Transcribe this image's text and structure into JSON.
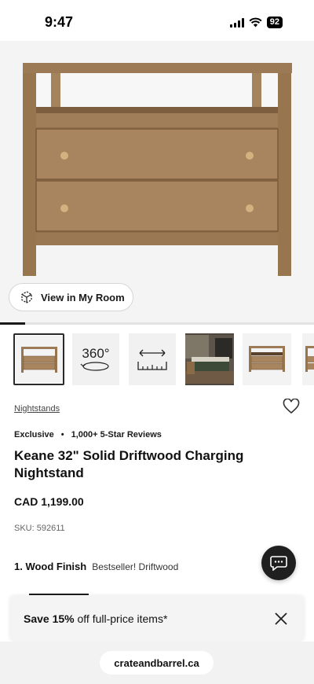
{
  "status": {
    "time": "9:47",
    "battery": "92"
  },
  "hero": {
    "view_in_room_label": "View in My Room",
    "carousel_progress": 0.08
  },
  "thumbnails": [
    {
      "kind": "nightstand-front",
      "selected": true
    },
    {
      "kind": "360-view",
      "label": "360°"
    },
    {
      "kind": "dimensions"
    },
    {
      "kind": "bedroom-scene"
    },
    {
      "kind": "nightstand-open"
    },
    {
      "kind": "nightstand-partial"
    }
  ],
  "product": {
    "category_link": "Nightstands",
    "badge": "Exclusive",
    "reviews": "1,000+ 5-Star Reviews",
    "title": "Keane 32\" Solid Driftwood Charging Nightstand",
    "price": "CAD 1,199.00",
    "sku": "SKU: 592611",
    "finish_label": "1. Wood Finish",
    "finish_value": "Bestseller! Driftwood"
  },
  "promo": {
    "bold": "Save 15%",
    "text": " off full-price items*"
  },
  "browser": {
    "url": "crateandbarrel.ca"
  },
  "colors": {
    "wood": "#a07e5a",
    "dark": "#1f1f1f",
    "hero_bg": "#f4f4f4"
  }
}
